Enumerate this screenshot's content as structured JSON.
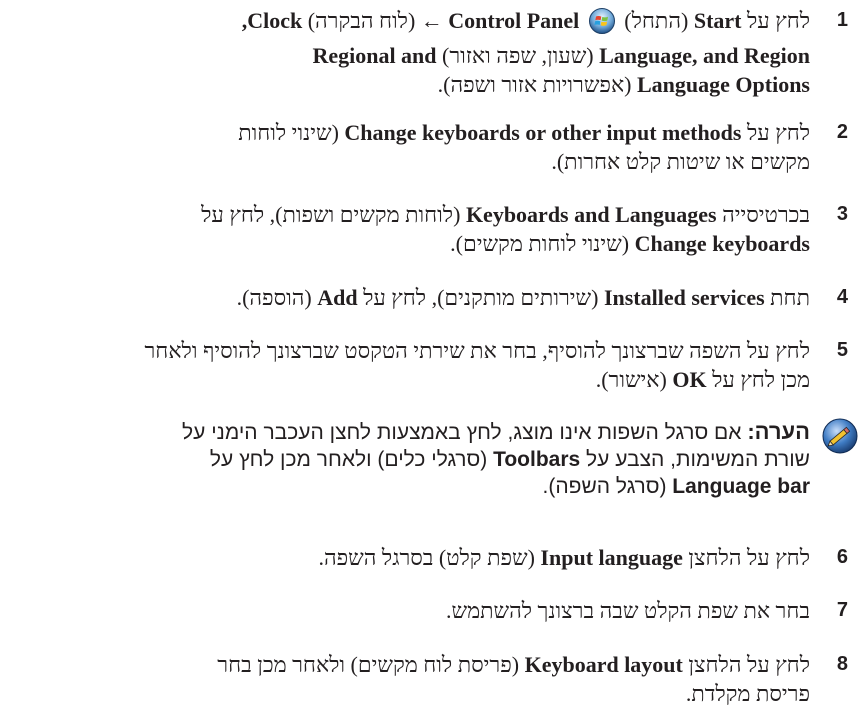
{
  "steps": [
    {
      "number": "1",
      "lines": [
        {
          "s1": "לחץ על ",
          "b1": "Start",
          "s2": " (התחל) ",
          "s3": " ",
          "b2": "Control Panel",
          "s4": " ← (לוח הבקרה) ",
          "b3": "Clock,",
          "s5": " ←"
        },
        {
          "b1": "Language, and Region",
          "s1": " (שעון, שפה ואזור) ",
          "b2": "Regional and",
          "s2": " ←"
        },
        {
          "b1": "Language Options",
          "s1": " (אפשרויות אזור ושפה)."
        }
      ]
    },
    {
      "number": "2",
      "lines": [
        {
          "s1": "לחץ על ",
          "b1": "Change keyboards or other input methods",
          "s2": " (שינוי לוחות"
        },
        {
          "s1": "מקשים או שיטות קלט אחרות)."
        }
      ]
    },
    {
      "number": "3",
      "lines": [
        {
          "s1": "בכרטיסייה ",
          "b1": "Keyboards and Languages",
          "s2": " (לוחות מקשים ושפות), לחץ על"
        },
        {
          "b1": "Change keyboards",
          "s1": " (שינוי לוחות מקשים)."
        }
      ]
    },
    {
      "number": "4",
      "lines": [
        {
          "s1": "תחת ",
          "b1": "Installed services",
          "s2": " (שירותים מותקנים), לחץ על ",
          "b2": "Add",
          "s3": " (הוספה)."
        }
      ]
    },
    {
      "number": "5",
      "lines": [
        {
          "s1": "לחץ על השפה שברצונך להוסיף, בחר את שירתי הטקסט שברצונך להוסיף ולאחר"
        },
        {
          "s1": "מכן לחץ על ",
          "b1": "OK",
          "s2": " (אישור)."
        }
      ]
    },
    {
      "number": "6",
      "lines": [
        {
          "s1": "לחץ על הלחצן ",
          "b1": "Input language",
          "s2": " (שפת קלט) בסרגל השפה."
        }
      ]
    },
    {
      "number": "7",
      "lines": [
        {
          "s1": "בחר את שפת הקלט שבה ברצונך להשתמש."
        }
      ]
    },
    {
      "number": "8",
      "lines": [
        {
          "s1": "לחץ על הלחצן ",
          "b1": "Keyboard layout",
          "s2": " (פריסת לוח מקשים) ולאחר מכן בחר"
        },
        {
          "s1": "פריסת מקלדת."
        }
      ]
    }
  ],
  "note": {
    "label": "הערה:",
    "lines": [
      {
        "s1": " אם סרגל השפות אינו מוצג, לחץ באמצעות לחצן העכבר הימני על"
      },
      {
        "s1": "שורת המשימות, הצבע על ",
        "b1": "Toolbars",
        "s2": " (סרגלי כלים) ולאחר מכן לחץ על"
      },
      {
        "b1": "Language bar",
        "s1": " (סרגל השפה)."
      }
    ]
  }
}
